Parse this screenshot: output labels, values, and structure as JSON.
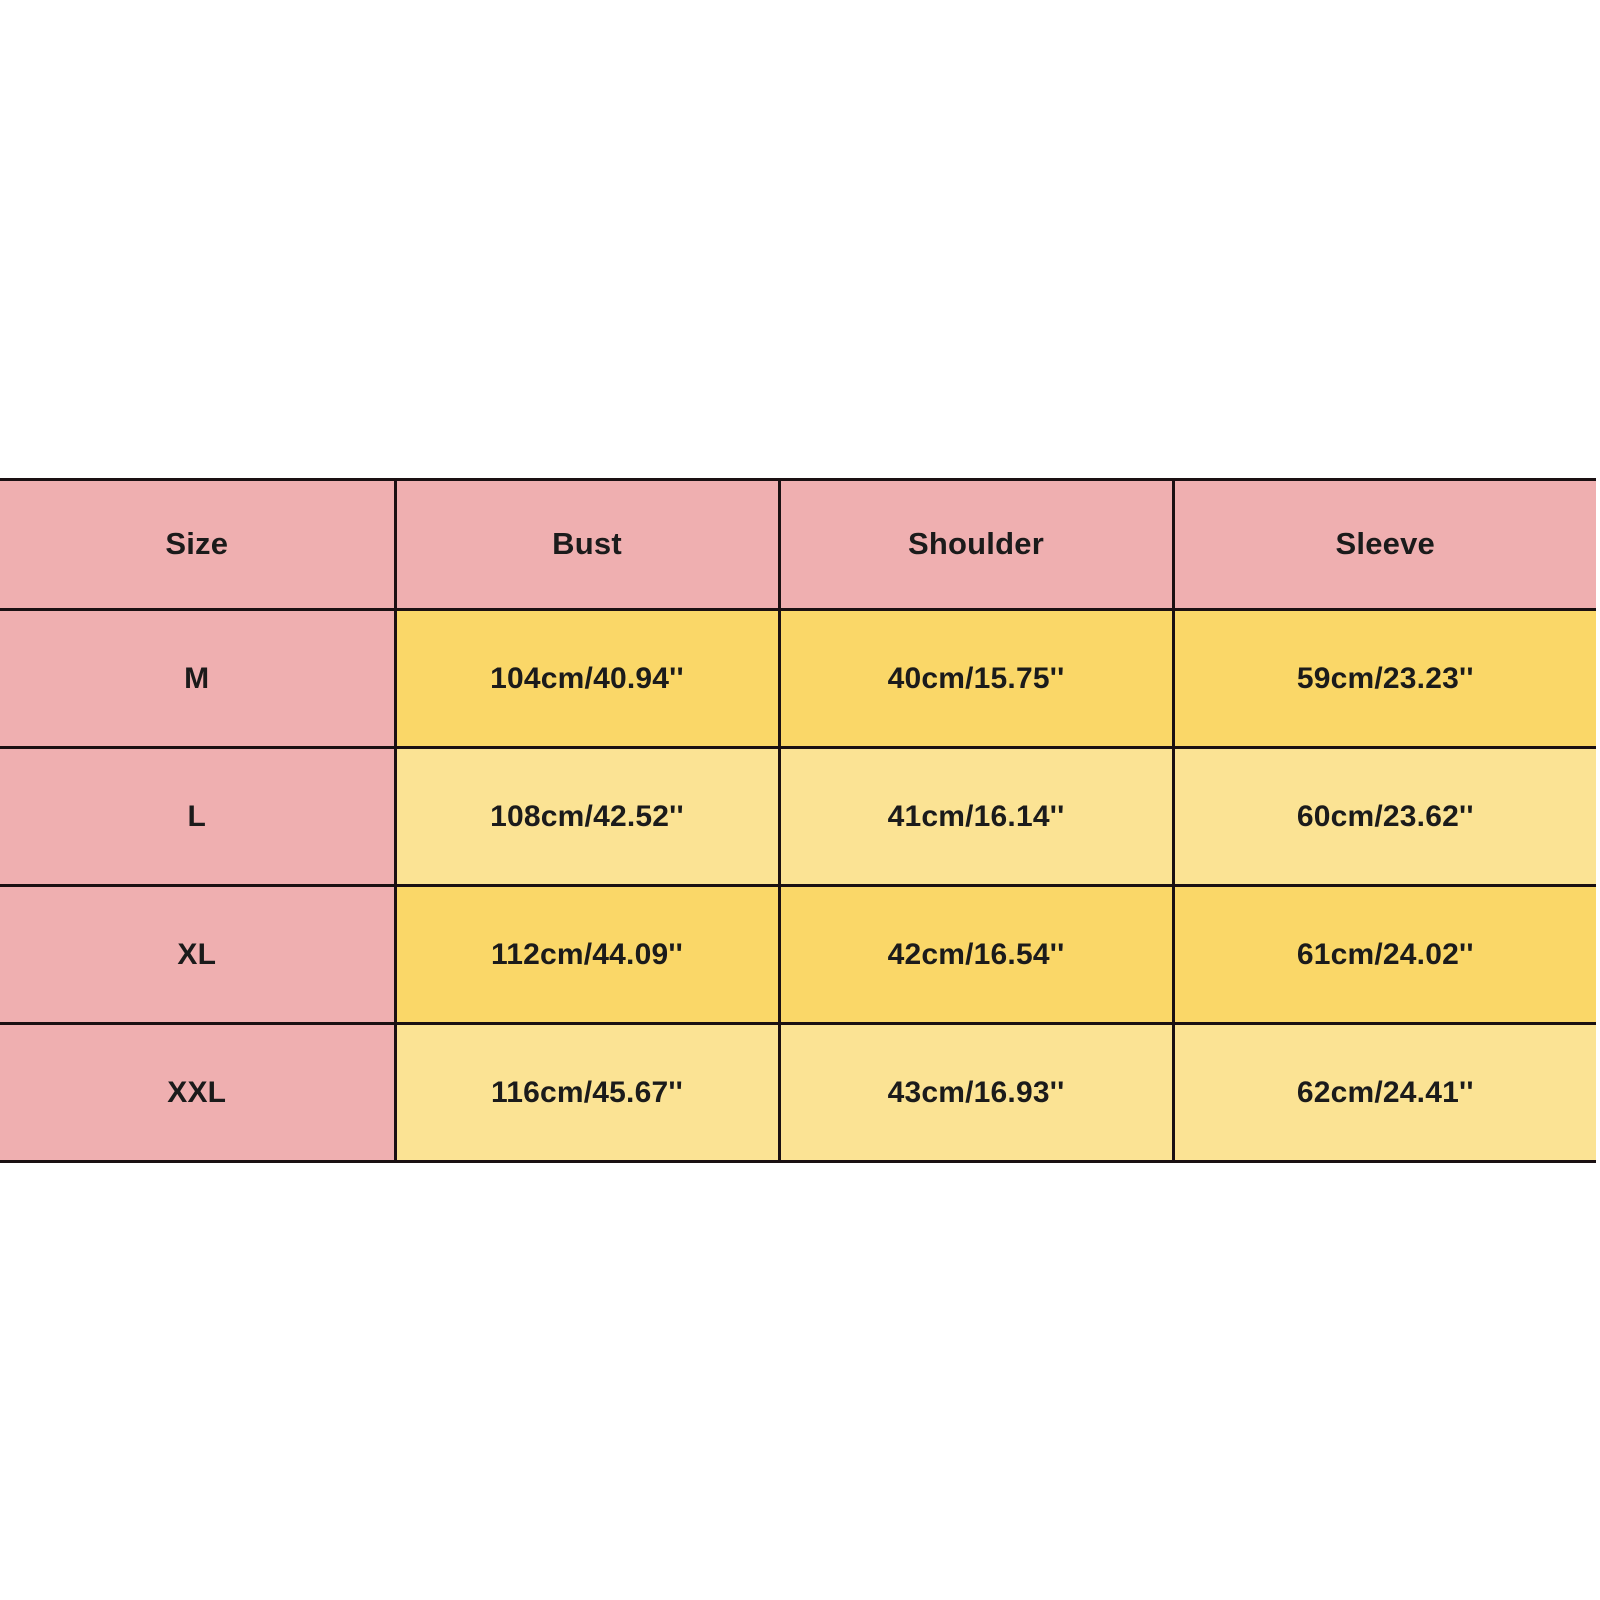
{
  "table": {
    "name": "size-chart",
    "columns": [
      {
        "key": "size",
        "label": "Size"
      },
      {
        "key": "bust",
        "label": "Bust"
      },
      {
        "key": "shoulder",
        "label": "Shoulder"
      },
      {
        "key": "sleeve",
        "label": "Sleeve"
      }
    ],
    "rows": [
      {
        "size": "M",
        "bust": "104cm/40.94''",
        "shoulder": "40cm/15.75''",
        "sleeve": "59cm/23.23''",
        "shade": "dark"
      },
      {
        "size": "L",
        "bust": "108cm/42.52''",
        "shoulder": "41cm/16.14''",
        "sleeve": "60cm/23.62''",
        "shade": "light"
      },
      {
        "size": "XL",
        "bust": "112cm/44.09''",
        "shoulder": "42cm/16.54''",
        "sleeve": "61cm/24.02''",
        "shade": "dark"
      },
      {
        "size": "XXL",
        "bust": "116cm/45.67''",
        "shoulder": "43cm/16.93''",
        "sleeve": "62cm/24.41''",
        "shade": "light"
      }
    ]
  },
  "colors": {
    "header_pink": "#efafb0",
    "size_column_pink": "#efafb0",
    "measure_yellow_dark": "#fad768",
    "measure_yellow_light": "#fbe394",
    "grid_line": "#1a1012",
    "text": "#1b1b1b",
    "background": "#ffffff"
  }
}
